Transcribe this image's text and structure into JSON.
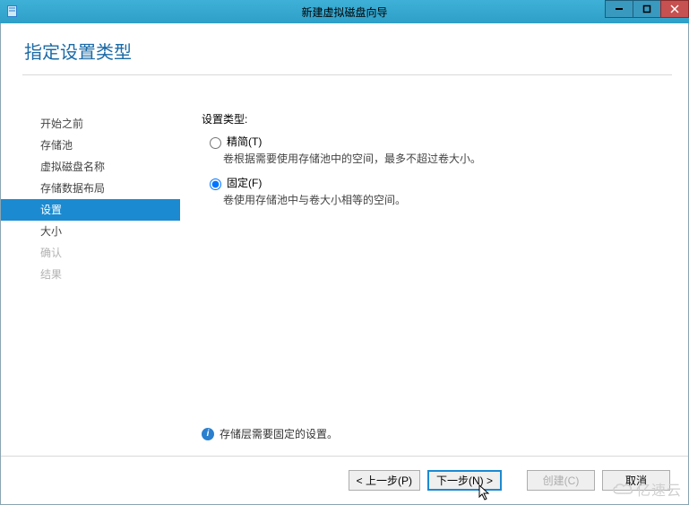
{
  "window": {
    "title": "新建虚拟磁盘向导",
    "minimize_tooltip": "最小化",
    "maximize_tooltip": "最大化",
    "close_tooltip": "关闭"
  },
  "page": {
    "heading": "指定设置类型"
  },
  "nav": {
    "items": [
      {
        "label": "开始之前",
        "state": "enabled"
      },
      {
        "label": "存储池",
        "state": "enabled"
      },
      {
        "label": "虚拟磁盘名称",
        "state": "enabled"
      },
      {
        "label": "存储数据布局",
        "state": "enabled"
      },
      {
        "label": "设置",
        "state": "active"
      },
      {
        "label": "大小",
        "state": "enabled"
      },
      {
        "label": "确认",
        "state": "disabled"
      },
      {
        "label": "结果",
        "state": "disabled"
      }
    ]
  },
  "panel": {
    "title": "设置类型:",
    "options": [
      {
        "id": "thin",
        "label": "精简(T)",
        "description": "卷根据需要使用存储池中的空间，最多不超过卷大小。",
        "selected": false
      },
      {
        "id": "fixed",
        "label": "固定(F)",
        "description": "卷使用存储池中与卷大小相等的空间。",
        "selected": true
      }
    ],
    "info": "存储层需要固定的设置。"
  },
  "footer": {
    "prev": "< 上一步(P)",
    "next": "下一步(N) >",
    "create": "创建(C)",
    "cancel": "取消"
  },
  "watermark": {
    "text": "亿速云"
  }
}
